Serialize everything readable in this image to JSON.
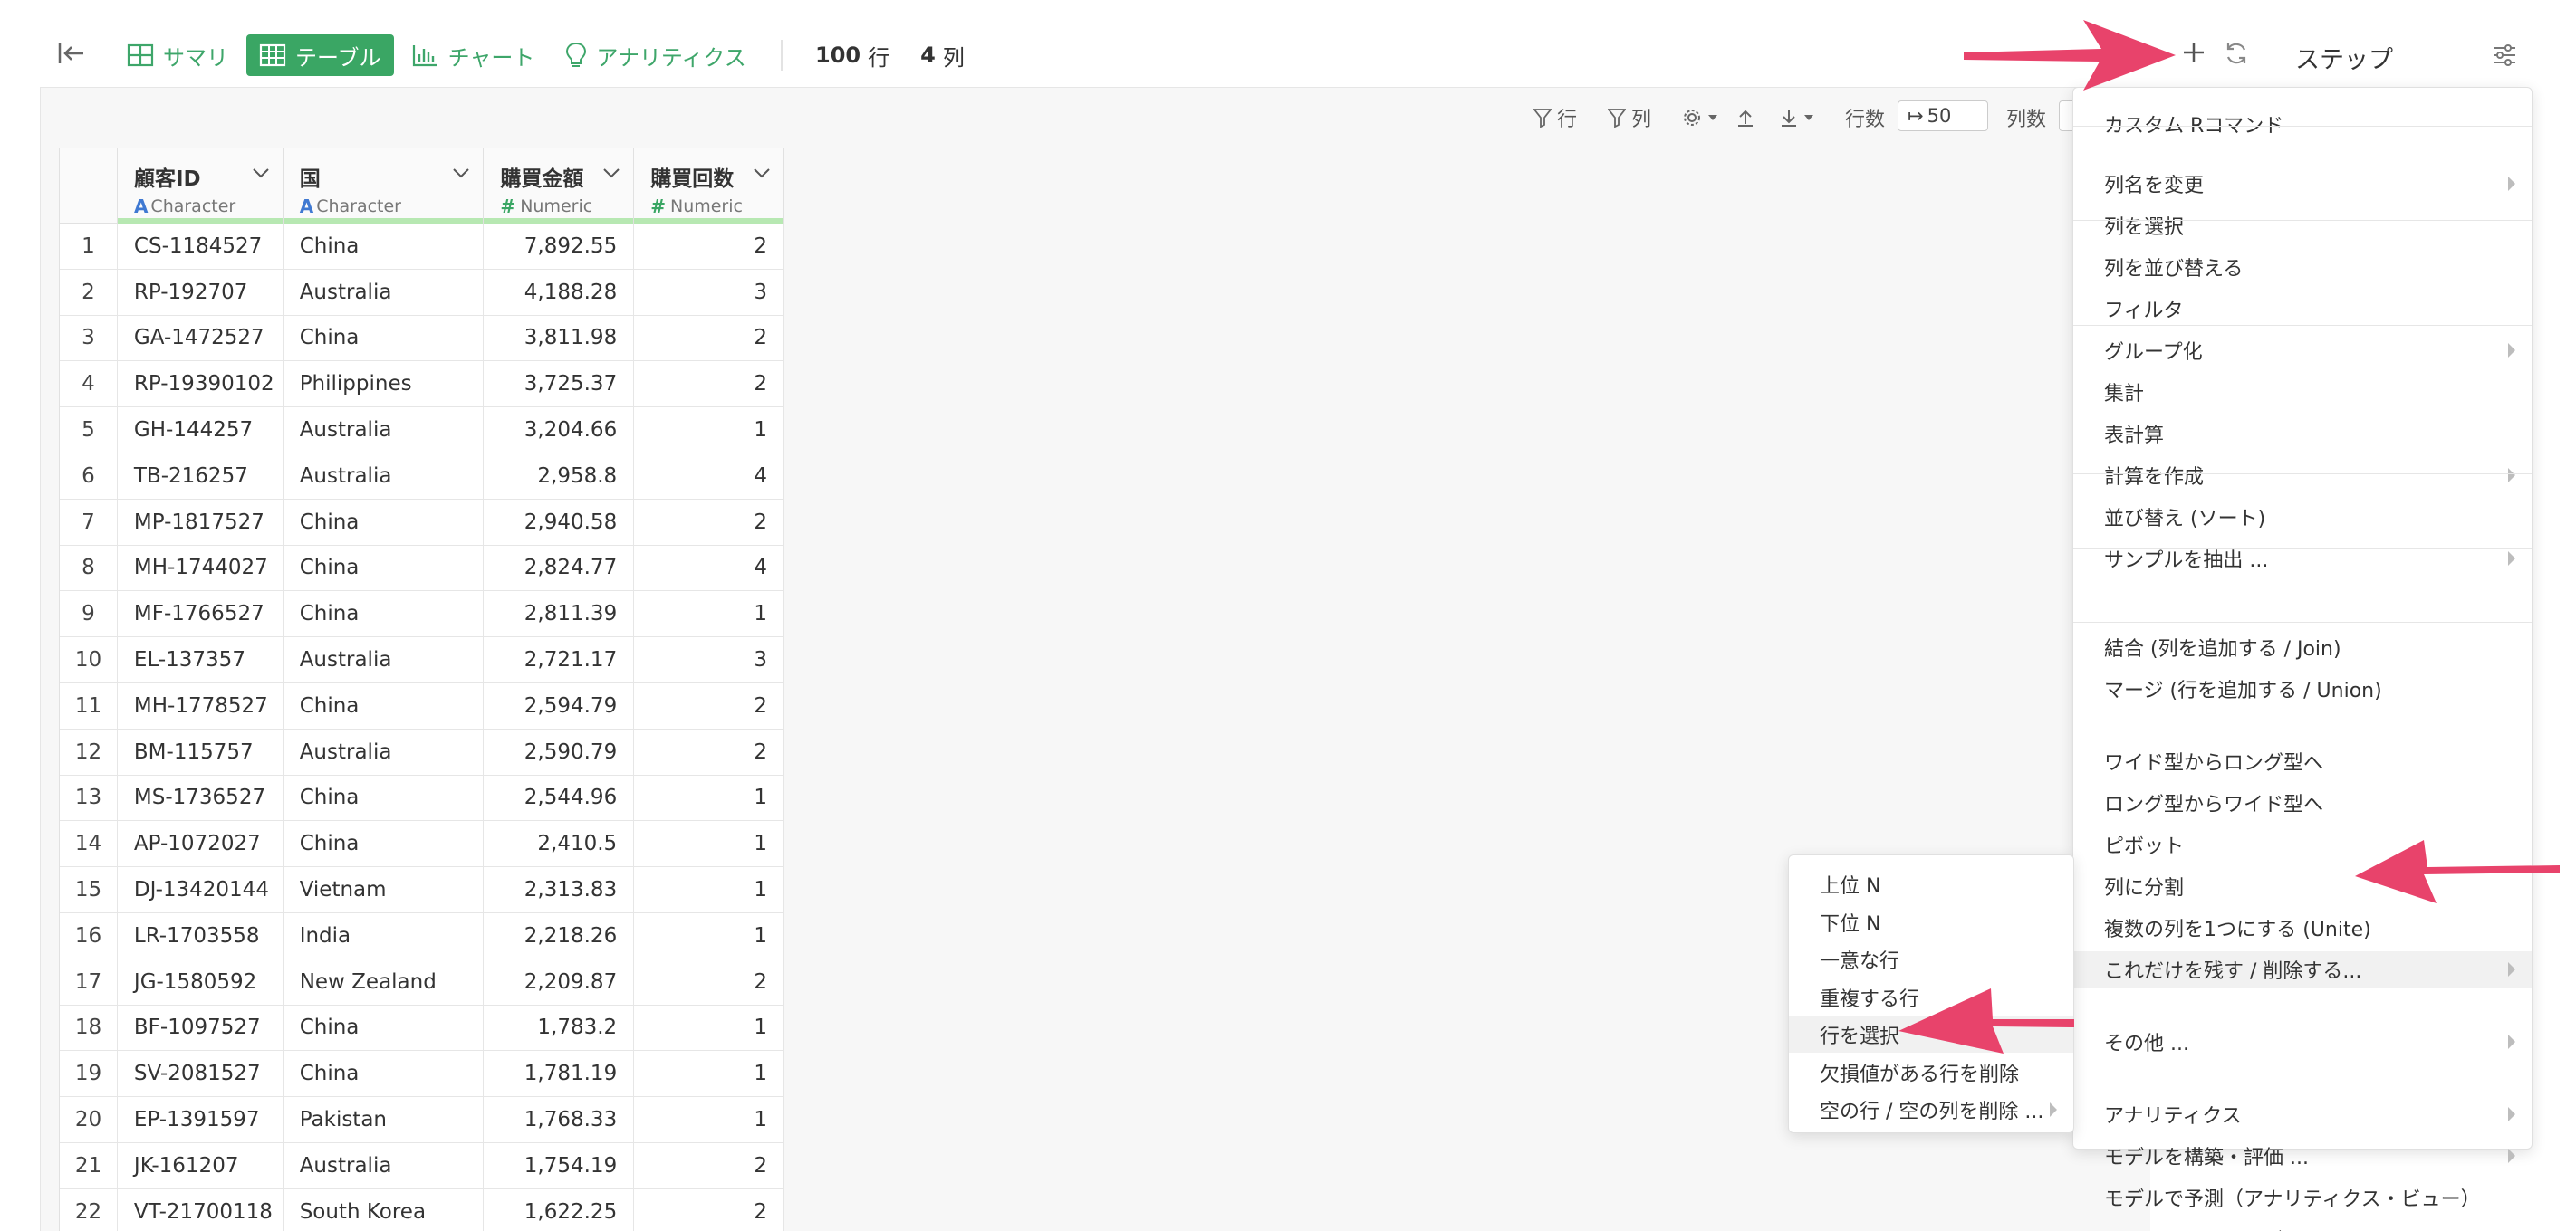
{
  "toolbar": {
    "tabs": [
      {
        "label": "サマリ",
        "icon": "summary-grid-icon"
      },
      {
        "label": "テーブル",
        "icon": "table-icon"
      },
      {
        "label": "チャート",
        "icon": "chart-icon"
      },
      {
        "label": "アナリティクス",
        "icon": "bulb-icon"
      }
    ],
    "row_count": "100",
    "row_unit": "行",
    "col_count": "4",
    "col_unit": "列",
    "steps_title": "ステップ"
  },
  "subbar": {
    "row_filter": "行",
    "col_filter": "列",
    "rows_label": "行数",
    "rows_value": "50",
    "cols_label": "列数"
  },
  "table": {
    "columns": [
      {
        "name": "顧客ID",
        "type": "Character"
      },
      {
        "name": "国",
        "type": "Character"
      },
      {
        "name": "購買金額",
        "type": "Numeric"
      },
      {
        "name": "購買回数",
        "type": "Numeric"
      }
    ],
    "rows": [
      [
        "1",
        "CS-1184527",
        "China",
        "7,892.55",
        "2"
      ],
      [
        "2",
        "RP-192707",
        "Australia",
        "4,188.28",
        "3"
      ],
      [
        "3",
        "GA-1472527",
        "China",
        "3,811.98",
        "2"
      ],
      [
        "4",
        "RP-19390102",
        "Philippines",
        "3,725.37",
        "2"
      ],
      [
        "5",
        "GH-144257",
        "Australia",
        "3,204.66",
        "1"
      ],
      [
        "6",
        "TB-216257",
        "Australia",
        "2,958.8",
        "4"
      ],
      [
        "7",
        "MP-1817527",
        "China",
        "2,940.58",
        "2"
      ],
      [
        "8",
        "MH-1744027",
        "China",
        "2,824.77",
        "4"
      ],
      [
        "9",
        "MF-1766527",
        "China",
        "2,811.39",
        "1"
      ],
      [
        "10",
        "EL-137357",
        "Australia",
        "2,721.17",
        "3"
      ],
      [
        "11",
        "MH-1778527",
        "China",
        "2,594.79",
        "2"
      ],
      [
        "12",
        "BM-115757",
        "Australia",
        "2,590.79",
        "2"
      ],
      [
        "13",
        "MS-1736527",
        "China",
        "2,544.96",
        "1"
      ],
      [
        "14",
        "AP-1072027",
        "China",
        "2,410.5",
        "1"
      ],
      [
        "15",
        "DJ-13420144",
        "Vietnam",
        "2,313.83",
        "1"
      ],
      [
        "16",
        "LR-1703558",
        "India",
        "2,218.26",
        "1"
      ],
      [
        "17",
        "JG-1580592",
        "New Zealand",
        "2,209.87",
        "2"
      ],
      [
        "18",
        "BF-1097527",
        "China",
        "1,783.2",
        "1"
      ],
      [
        "19",
        "SV-2081527",
        "China",
        "1,781.19",
        "1"
      ],
      [
        "20",
        "EP-1391597",
        "Pakistan",
        "1,768.33",
        "1"
      ],
      [
        "21",
        "JK-161207",
        "Australia",
        "1,754.19",
        "2"
      ],
      [
        "22",
        "VT-21700118",
        "South Korea",
        "1,622.25",
        "2"
      ]
    ]
  },
  "main_menu": {
    "items": [
      {
        "label": "カスタム Rコマンド",
        "submenu": false
      },
      {
        "label": "列名を変更",
        "submenu": true
      },
      {
        "label": "列を選択",
        "submenu": false
      },
      {
        "label": "列を並び替える",
        "submenu": false
      },
      {
        "label": "フィルタ",
        "submenu": false
      },
      {
        "label": "グループ化",
        "submenu": true
      },
      {
        "label": "集計",
        "submenu": false
      },
      {
        "label": "表計算",
        "submenu": false
      },
      {
        "label": "計算を作成",
        "submenu": true
      },
      {
        "label": "並び替え (ソート)",
        "submenu": false
      },
      {
        "label": "サンプルを抽出 ...",
        "submenu": true
      },
      {
        "label": "結合 (列を追加する / Join)",
        "submenu": false
      },
      {
        "label": "マージ (行を追加する / Union)",
        "submenu": false
      },
      {
        "label": "ワイド型からロング型へ",
        "submenu": false
      },
      {
        "label": "ロング型からワイド型へ",
        "submenu": false
      },
      {
        "label": "ピボット",
        "submenu": false
      },
      {
        "label": "列に分割",
        "submenu": false
      },
      {
        "label": "複数の列を1つにする (Unite)",
        "submenu": false
      },
      {
        "label": "これだけを残す / 削除する...",
        "submenu": true
      },
      {
        "label": "その他 ...",
        "submenu": true
      },
      {
        "label": "アナリティクス",
        "submenu": true
      },
      {
        "label": "モデルを構築・評価 ...",
        "submenu": true
      },
      {
        "label": "モデルで予測（アナリティクス・ビュー）",
        "submenu": false
      },
      {
        "label": "テキストマイニング ...",
        "submenu": true
      }
    ]
  },
  "sub_menu": {
    "items": [
      {
        "label": "上位 N",
        "submenu": false
      },
      {
        "label": "下位 N",
        "submenu": false
      },
      {
        "label": "一意な行",
        "submenu": false
      },
      {
        "label": "重複する行",
        "submenu": false
      },
      {
        "label": "行を選択",
        "submenu": false
      },
      {
        "label": "欠損値がある行を削除",
        "submenu": false
      },
      {
        "label": "空の行 / 空の列を削除 ...",
        "submenu": true
      }
    ]
  },
  "colors": {
    "accent_green": "#3aa664",
    "pointer_pink": "#e8436b",
    "type_blue": "#3f79d2"
  }
}
